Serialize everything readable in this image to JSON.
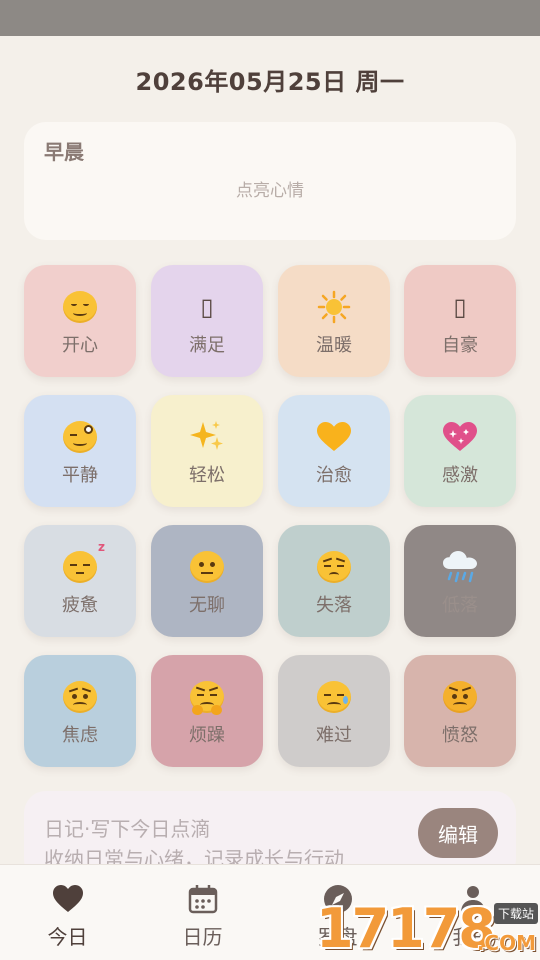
{
  "header": {
    "date": "2026年05月25日 周一"
  },
  "morning_card": {
    "label": "早晨",
    "hint": "点亮心情"
  },
  "moods": [
    {
      "label": "开心",
      "icon": "smiling-face-icon",
      "color": "#f1cfcc"
    },
    {
      "label": "满足",
      "icon": "unknown-glyph-icon",
      "glyph": "▯",
      "color": "#e4d4ec"
    },
    {
      "label": "温暖",
      "icon": "sun-icon",
      "color": "#f5dcc6"
    },
    {
      "label": "自豪",
      "icon": "unknown-glyph-icon",
      "glyph": "▯",
      "color": "#efcac5"
    },
    {
      "label": "平静",
      "icon": "relieved-face-icon",
      "color": "#d4e0f2"
    },
    {
      "label": "轻松",
      "icon": "sparkles-icon",
      "color": "#f7f0cd"
    },
    {
      "label": "治愈",
      "icon": "yellow-heart-icon",
      "color": "#d5e3f1"
    },
    {
      "label": "感激",
      "icon": "sparkling-heart-icon",
      "color": "#d5e6d9"
    },
    {
      "label": "疲惫",
      "icon": "sleeping-face-icon",
      "color": "#d8dde3"
    },
    {
      "label": "无聊",
      "icon": "neutral-face-icon",
      "color": "#aeb5c3"
    },
    {
      "label": "失落",
      "icon": "pensive-face-icon",
      "color": "#bfcfcd"
    },
    {
      "label": "低落",
      "icon": "rain-cloud-icon",
      "color": "#908886"
    },
    {
      "label": "焦虑",
      "icon": "worried-face-icon",
      "color": "#b9cfdd"
    },
    {
      "label": "烦躁",
      "icon": "steaming-face-icon",
      "color": "#d6a3aa"
    },
    {
      "label": "难过",
      "icon": "crying-face-icon",
      "color": "#cfcccb"
    },
    {
      "label": "愤怒",
      "icon": "angry-face-icon",
      "color": "#d7b4ac"
    }
  ],
  "diary": {
    "title": "日记·写下今日点滴",
    "subtitle": "收纳日常与心绪，记录成长与行动",
    "edit_label": "编辑"
  },
  "nav": [
    {
      "label": "今日",
      "icon": "heart-icon",
      "active": true
    },
    {
      "label": "日历",
      "icon": "calendar-icon",
      "active": false
    },
    {
      "label": "罗盘",
      "icon": "compass-icon",
      "active": false
    },
    {
      "label": "我的",
      "icon": "person-icon",
      "active": false
    }
  ],
  "watermark": {
    "number": "17178",
    "tag": "下载站",
    "suffix": ".COM"
  }
}
